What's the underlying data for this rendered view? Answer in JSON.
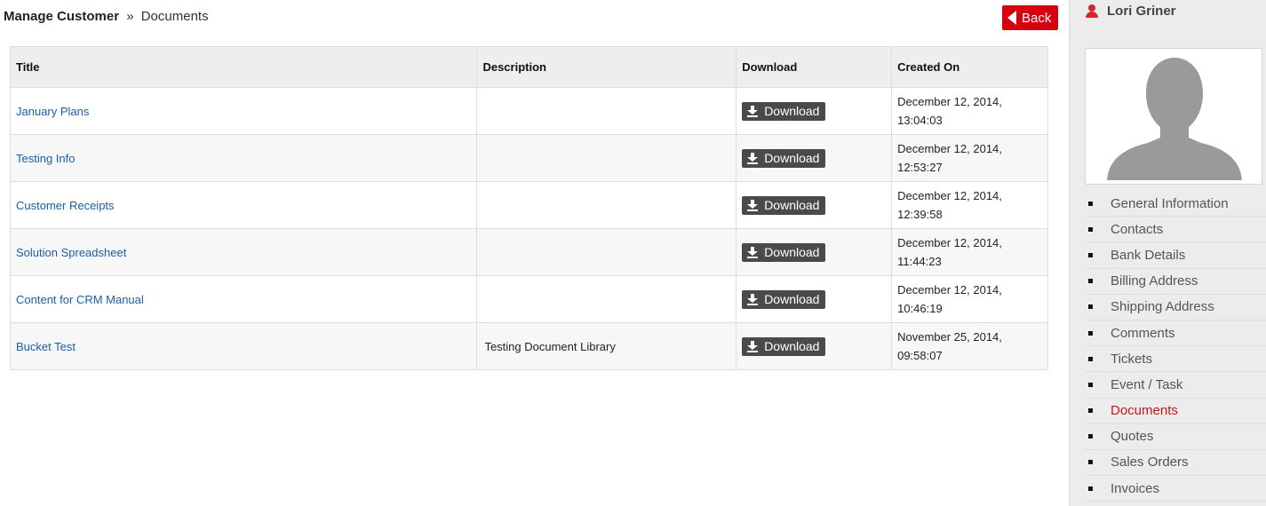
{
  "breadcrumb": {
    "root": "Manage Customer",
    "separator": "»",
    "current": "Documents"
  },
  "back_button": {
    "label": "Back"
  },
  "table": {
    "headers": {
      "title": "Title",
      "description": "Description",
      "download": "Download",
      "created_on": "Created On"
    },
    "rows": [
      {
        "title": "January Plans",
        "description": "",
        "download": "Download",
        "created_date": "December 12, 2014,",
        "created_time": "13:04:03"
      },
      {
        "title": "Testing Info",
        "description": "",
        "download": "Download",
        "created_date": "December 12, 2014,",
        "created_time": "12:53:27"
      },
      {
        "title": "Customer Receipts",
        "description": "",
        "download": "Download",
        "created_date": "December 12, 2014,",
        "created_time": "12:39:58"
      },
      {
        "title": "Solution Spreadsheet",
        "description": "",
        "download": "Download",
        "created_date": "December 12, 2014,",
        "created_time": "11:44:23"
      },
      {
        "title": "Content for CRM Manual",
        "description": "",
        "download": "Download",
        "created_date": "December 12, 2014,",
        "created_time": "10:46:19"
      },
      {
        "title": "Bucket Test",
        "description": "Testing Document Library",
        "download": "Download",
        "created_date": "November 25, 2014,",
        "created_time": "09:58:07"
      }
    ]
  },
  "sidebar": {
    "user_name": "Lori Griner",
    "user_icon": "user-icon",
    "avatar_icon": "avatar-placeholder",
    "items": [
      {
        "label": "General Information",
        "active": false
      },
      {
        "label": "Contacts",
        "active": false
      },
      {
        "label": "Bank Details",
        "active": false
      },
      {
        "label": "Billing Address",
        "active": false
      },
      {
        "label": "Shipping Address",
        "active": false
      },
      {
        "label": "Comments",
        "active": false
      },
      {
        "label": "Tickets",
        "active": false
      },
      {
        "label": "Event / Task",
        "active": false
      },
      {
        "label": "Documents",
        "active": true
      },
      {
        "label": "Quotes",
        "active": false
      },
      {
        "label": "Sales Orders",
        "active": false
      },
      {
        "label": "Invoices",
        "active": false
      }
    ]
  },
  "colors": {
    "accent_red": "#d7000f",
    "link_blue": "#1d5ea6",
    "button_dark": "#4a4a4a",
    "active_nav": "#c4161c"
  }
}
